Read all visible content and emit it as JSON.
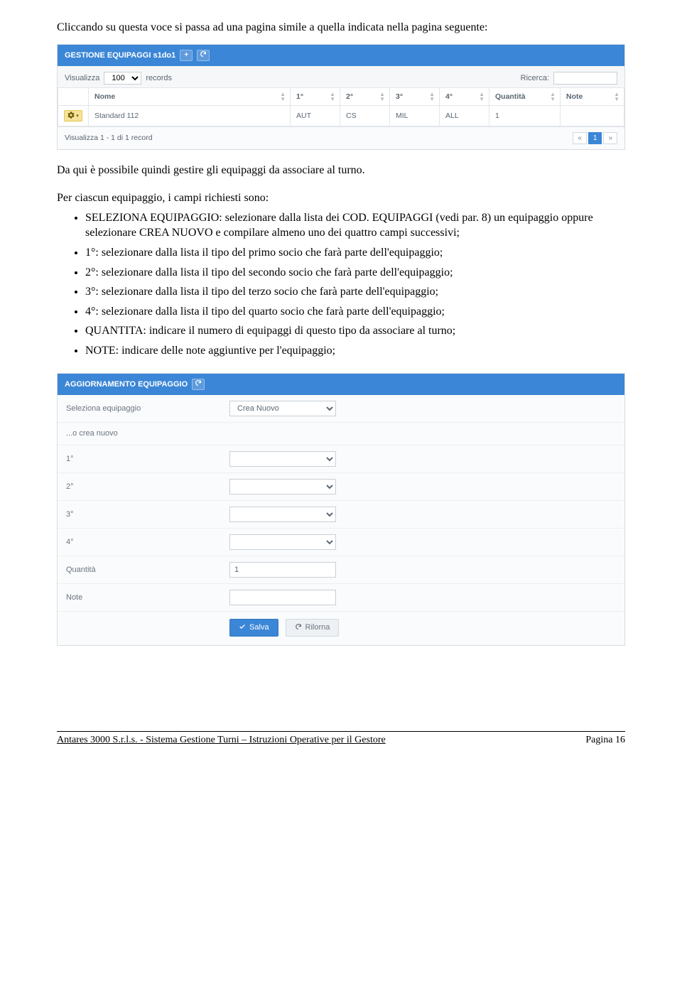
{
  "intro_text": "Cliccando su questa voce si passa ad una pagina simile a quella indicata nella pagina seguente:",
  "panel1": {
    "title": "GESTIONE EQUIPAGGI s1do1",
    "show_label_pre": "Visualizza",
    "show_value": "100",
    "show_label_post": "records",
    "search_label": "Ricerca:",
    "columns": {
      "nome": "Nome",
      "c1": "1°",
      "c2": "2°",
      "c3": "3°",
      "c4": "4°",
      "qty": "Quantità",
      "note": "Note"
    },
    "row": {
      "nome": "Standard 112",
      "c1": "AUT",
      "c2": "CS",
      "c3": "MIL",
      "c4": "ALL",
      "qty": "1",
      "note": ""
    },
    "footer_info": "Visualizza 1 - 1 di 1 record",
    "pager_prev": "«",
    "pager_page": "1",
    "pager_next": "»"
  },
  "mid": {
    "p1": "Da qui è possibile quindi gestire gli equipaggi da associare al turno.",
    "p2": "Per ciascun equipaggio, i campi richiesti sono:",
    "bullets": [
      "SELEZIONA EQUIPAGGIO: selezionare dalla lista dei COD. EQUIPAGGI (vedi par. 8) un equipaggio oppure selezionare CREA NUOVO e compilare almeno uno dei quattro campi successivi;",
      "1°: selezionare dalla lista il tipo del primo socio che farà parte dell'equipaggio;",
      "2°: selezionare dalla lista il tipo del secondo socio che farà parte dell'equipaggio;",
      "3°: selezionare dalla lista il tipo del terzo socio che farà parte dell'equipaggio;",
      "4°: selezionare dalla lista il tipo del quarto socio che farà parte dell'equipaggio;",
      "QUANTITA: indicare il numero di equipaggi di questo tipo da associare al turno;",
      "NOTE: indicare delle note aggiuntive per l'equipaggio;"
    ]
  },
  "panel2": {
    "title": "AGGIORNAMENTO EQUIPAGGIO",
    "rows": {
      "sel_equip_label": "Seleziona equipaggio",
      "sel_equip_value": "Crea Nuovo",
      "crea_nuovo_label": "...o crea nuovo",
      "c1_label": "1°",
      "c2_label": "2°",
      "c3_label": "3°",
      "c4_label": "4°",
      "qty_label": "Quantità",
      "qty_value": "1",
      "note_label": "Note",
      "note_value": ""
    },
    "save_label": "Salva",
    "reset_label": "Rilorna"
  },
  "footer": {
    "left": "Antares 3000 S.r.l.s. - Sistema Gestione Turni – Istruzioni Operative per il Gestore",
    "right": "Pagina 16"
  }
}
